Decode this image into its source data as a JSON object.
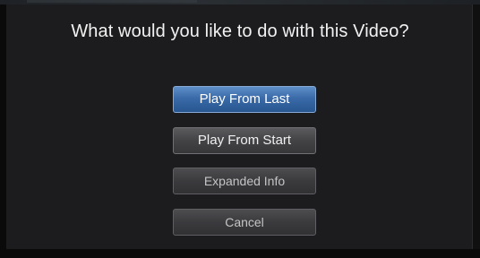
{
  "dialog": {
    "title": "What would you like to do with this Video?",
    "buttons": [
      {
        "label": "Play From Last",
        "state": "focused"
      },
      {
        "label": "Play From Start",
        "state": "normal"
      },
      {
        "label": "Expanded Info",
        "state": "normal"
      },
      {
        "label": "Cancel",
        "state": "normal"
      }
    ]
  },
  "colors": {
    "focused_button": "#3a6aa8",
    "button": "#434346",
    "dialog_background": "#1c1c1e",
    "title_text": "#f2f2f2"
  }
}
